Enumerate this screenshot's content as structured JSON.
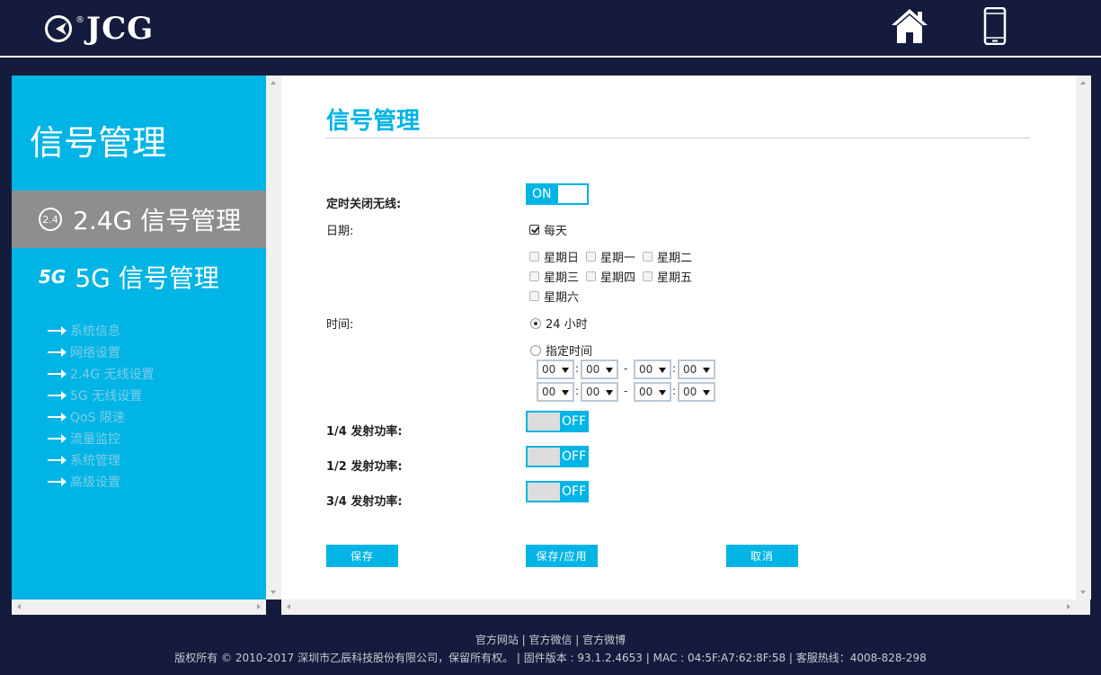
{
  "header": {
    "logo_text": "JCG",
    "logo_reg": "®",
    "home_icon": "home-icon",
    "phone_icon": "mobile-phone-icon"
  },
  "sidebar": {
    "title": "信号管理",
    "items": [
      {
        "badge": "2.4",
        "label": "2.4G 信号管理"
      },
      {
        "badge": "5G",
        "label": "5G 信号管理"
      }
    ],
    "links": [
      "系统信息",
      "网络设置",
      "2.4G 无线设置",
      "5G 无线设置",
      "QoS 限速",
      "流量监控",
      "系统管理",
      "高级设置"
    ]
  },
  "main": {
    "title": "信号管理",
    "schedule_label": "定时关闭无线:",
    "schedule_toggle": "ON",
    "date_label": "日期:",
    "everyday": "每天",
    "weekdays": [
      "星期日",
      "星期一",
      "星期二",
      "星期三",
      "星期四",
      "星期五",
      "星期六"
    ],
    "time_label": "时间:",
    "time_24h": "24 小时",
    "time_custom": "指定时间",
    "time_rows": [
      [
        "00",
        "00",
        "00",
        "00"
      ],
      [
        "00",
        "00",
        "00",
        "00"
      ]
    ],
    "time_colon": ":",
    "time_dash": "-",
    "power_quarter_label": "1/4 发射功率:",
    "power_half_label": "1/2 发射功率:",
    "power_three_quarter_label": "3/4 发射功率:",
    "off_text": "OFF",
    "buttons": {
      "save": "保存",
      "save_apply": "保存/应用",
      "cancel": "取消"
    }
  },
  "footer": {
    "links": "官方网站 | 官方微信 | 官方微博",
    "copyright": "版权所有 © 2010-2017 深圳市乙辰科技股份有限公司，保留所有权。 | 固件版本 : 93.1.2.4653 | MAC : 04:5F:A7:62:8F:58 | 客服热线：4008-828-298"
  }
}
